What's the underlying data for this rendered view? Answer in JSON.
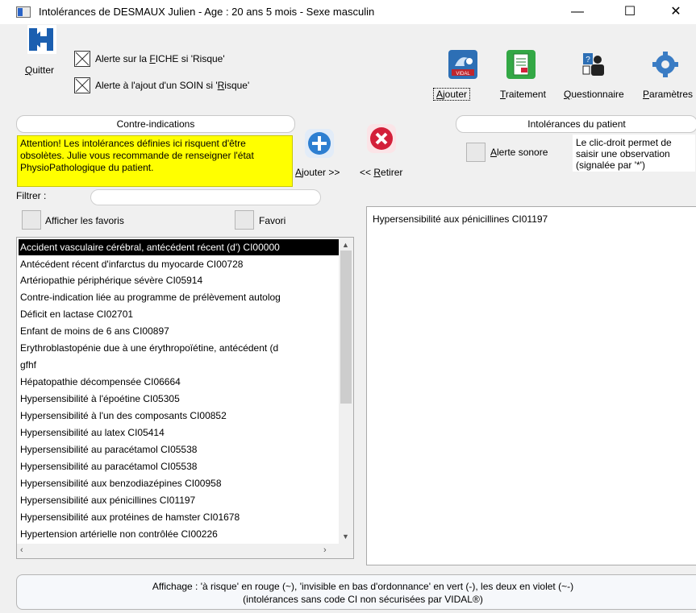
{
  "window": {
    "title": "Intolérances de DESMAUX Julien - Age : 20 ans 5 mois - Sexe masculin",
    "min_glyph": "—",
    "max_glyph": "☐",
    "close_glyph": "✕"
  },
  "toolbar": {
    "quit_label_u": "Q",
    "quit_label_rest": "uitter",
    "alert_fiche_pre": "Alerte sur la ",
    "alert_fiche_u": "F",
    "alert_fiche_post": "ICHE si 'Risque'",
    "alert_soin_pre": "Alerte à l'ajout d'un SOIN si '",
    "alert_soin_u": "R",
    "alert_soin_post": "isque'",
    "ajouter_u": "A",
    "ajouter_rest": "jouter",
    "vidal_text": "VIDAL",
    "traitement_u": "T",
    "traitement_rest": "raitement",
    "questionnaire_u": "Q",
    "questionnaire_rest": "uestionnaire",
    "parametres_u": "P",
    "parametres_rest": "aramètres"
  },
  "left_panel": {
    "header": "Contre-indications",
    "warning": "Attention! Les intolérances définies ici risquent d'être obsolètes. Julie vous recommande de renseigner l'état PhysioPathologique du patient.",
    "filter_label": "Filtrer :",
    "filter_value": "",
    "show_favorites_label": "Afficher les favoris",
    "favori_label": "Favori",
    "items": [
      "Accident vasculaire cérébral, antécédent récent (d') CI00000",
      "Antécédent récent d'infarctus du myocarde CI00728",
      "Artériopathie périphérique sévère CI05914",
      "Contre-indication liée au programme de prélèvement autolog",
      "Déficit en lactase CI02701",
      "Enfant de moins de 6 ans CI00897",
      "Erythroblastopénie due à une érythropoïétine, antécédent (d",
      "gfhf",
      "Hépatopathie décompensée CI06664",
      "Hypersensibilité à l'époétine CI05305",
      "Hypersensibilité à l'un des composants CI00852",
      "Hypersensibilité au latex CI05414",
      "Hypersensibilité au paracétamol CI05538",
      "Hypersensibilité au paracétamol CI05538",
      "Hypersensibilité aux benzodiazépines CI00958",
      "Hypersensibilité aux pénicillines CI01197",
      "Hypersensibilité aux protéines de hamster CI01678",
      "Hypertension artérielle non contrôlée CI00226"
    ]
  },
  "actions": {
    "add_u": "A",
    "add_rest": "jouter >>",
    "remove_pre": "<< ",
    "remove_u": "R",
    "remove_rest": "etirer"
  },
  "right_panel": {
    "header": "Intolérances du patient",
    "alert_sound_u": "A",
    "alert_sound_rest": "lerte sonore",
    "hint": "Le clic-droit permet de saisir une observation (signalée par '*')",
    "items": [
      "Hypersensibilité aux pénicillines CI01197"
    ]
  },
  "footer": {
    "line1": "Affichage : 'à risque' en rouge (~), 'invisible en bas d'ordonnance' en vert (-), les deux en violet (~-)",
    "line2": "(intolérances sans code CI non sécurisées par VIDAL®)"
  },
  "colors": {
    "warning_bg": "#ffff00",
    "add_btn": "#2e7fd1",
    "remove_btn": "#d3203a",
    "selected_row": "#000000"
  }
}
